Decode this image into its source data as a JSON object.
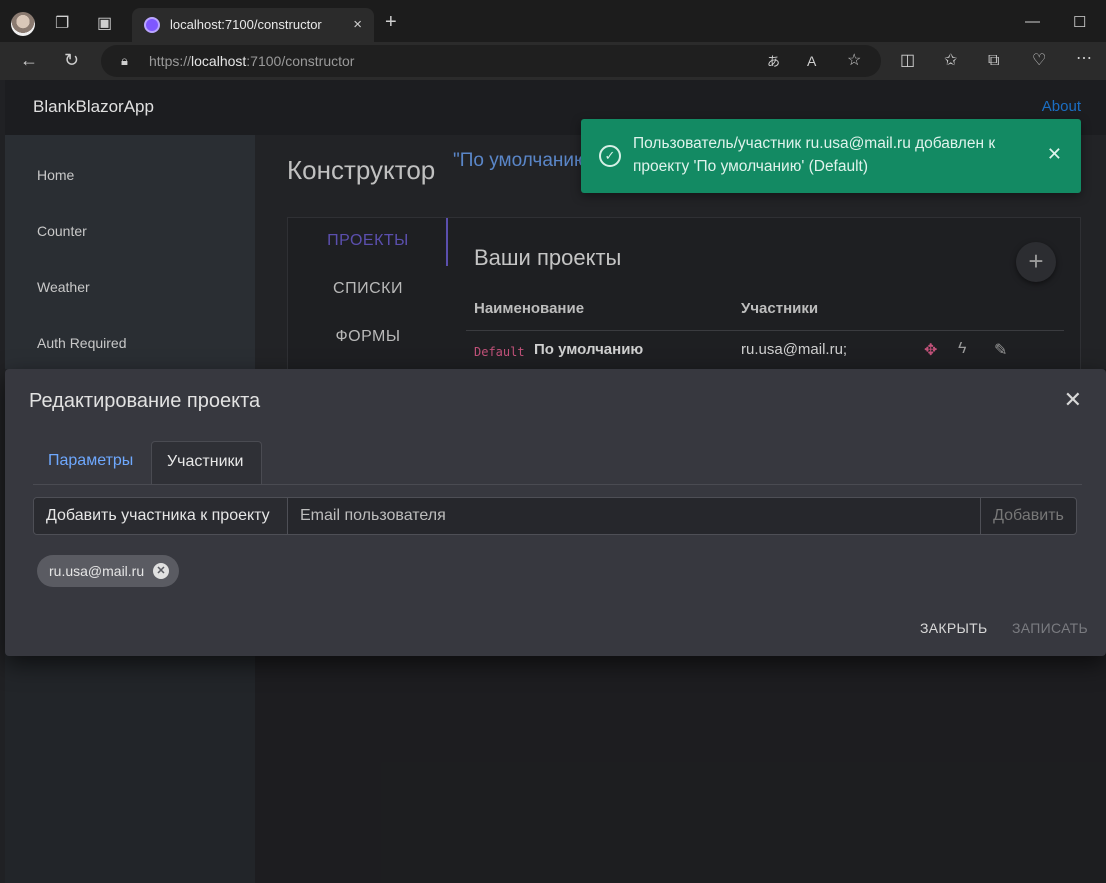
{
  "browser": {
    "tab_title": "localhost:7100/constructor",
    "tab_close_icon": "×",
    "new_tab_icon": "+",
    "url_prefix": "https://",
    "url_host": "localhost",
    "url_rest": ":7100/constructor",
    "toolbar_icons": [
      "back-icon",
      "refresh-icon",
      "lock-icon",
      "translate-icon",
      "read-aloud-icon",
      "favorite-icon",
      "split-screen-icon",
      "favorites-icon",
      "collections-icon",
      "health-icon",
      "more-icon"
    ]
  },
  "app": {
    "brand": "BlankBlazorApp",
    "about": "About",
    "nav": [
      "Home",
      "Counter",
      "Weather",
      "Auth Required"
    ]
  },
  "page": {
    "title": "Конструктор",
    "project": "\"По умолчанию"
  },
  "projects": {
    "tabs": [
      "ПРОЕКТЫ",
      "СПИСКИ",
      "ФОРМЫ"
    ],
    "title": "Ваши проекты",
    "add_icon": "+",
    "col_name": "Наименование",
    "col_members": "Участники",
    "row": {
      "code": "Default",
      "name": "По умолчанию",
      "members": "ru.usa@mail.ru;"
    }
  },
  "toast": {
    "message": "Пользователь/участник ru.usa@mail.ru добавлен к проекту 'По умолчанию' (Default)",
    "check_icon": "✓",
    "close_icon": "✕"
  },
  "dialog": {
    "title": "Редактирование проекта",
    "close_icon": "✕",
    "tab_params": "Параметры",
    "tab_members": "Участники",
    "add_label": "Добавить участника к проекту",
    "email_placeholder": "Email пользователя",
    "add_button": "Добавить",
    "member_chip": "ru.usa@mail.ru",
    "chip_remove_icon": "✕",
    "btn_close": "ЗАКРЫТЬ",
    "btn_save": "ЗАПИСАТЬ"
  },
  "colors": {
    "toast_bg": "#138a63",
    "accent": "#5b4fae",
    "link": "#6ea8fe"
  }
}
